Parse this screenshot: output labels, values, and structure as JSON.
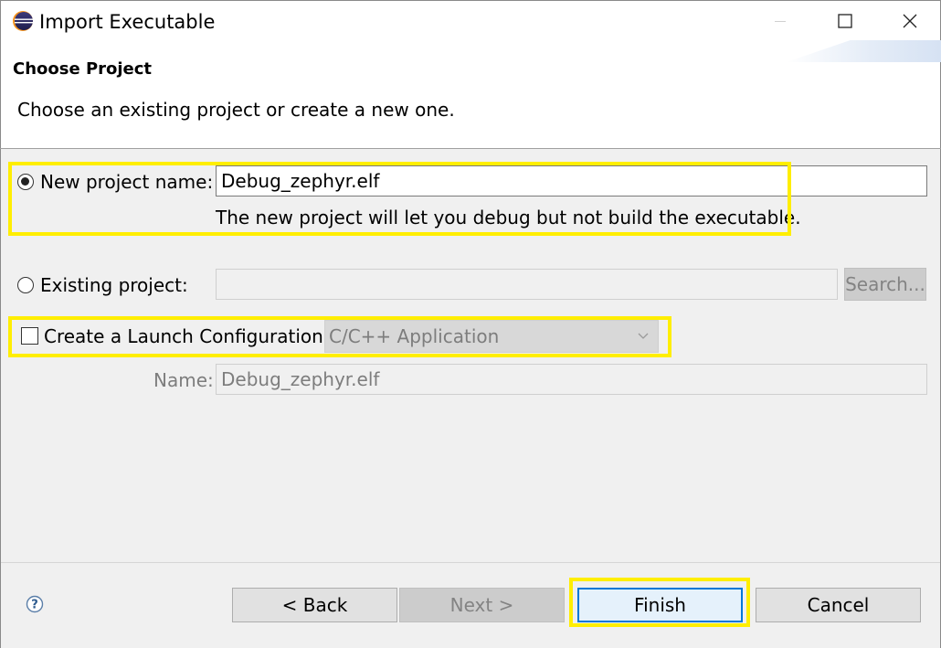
{
  "window": {
    "title": "Import Executable",
    "controls": {
      "minimize": "—",
      "maximize": "☐",
      "close": "✕"
    }
  },
  "header": {
    "title": "Choose Project",
    "description": "Choose an existing project or create a new one."
  },
  "new_project": {
    "label": "New project name:",
    "value": "Debug_zephyr.elf",
    "selected": true,
    "note": "The new project will let you debug but not build the executable."
  },
  "existing_project": {
    "label": "Existing project:",
    "value": "",
    "selected": false,
    "search_label": "Search..."
  },
  "launch_config": {
    "label": "Create a Launch Configuration:",
    "checked": false,
    "type_value": "C/C++ Application",
    "name_label": "Name:",
    "name_value": "Debug_zephyr.elf"
  },
  "footer": {
    "help_icon": "help-icon",
    "back_label": "< Back",
    "next_label": "Next >",
    "finish_label": "Finish",
    "cancel_label": "Cancel"
  },
  "colors": {
    "highlight": "#ffee00",
    "default_button_border": "#0078d7",
    "panel": "#f0f0f0"
  }
}
